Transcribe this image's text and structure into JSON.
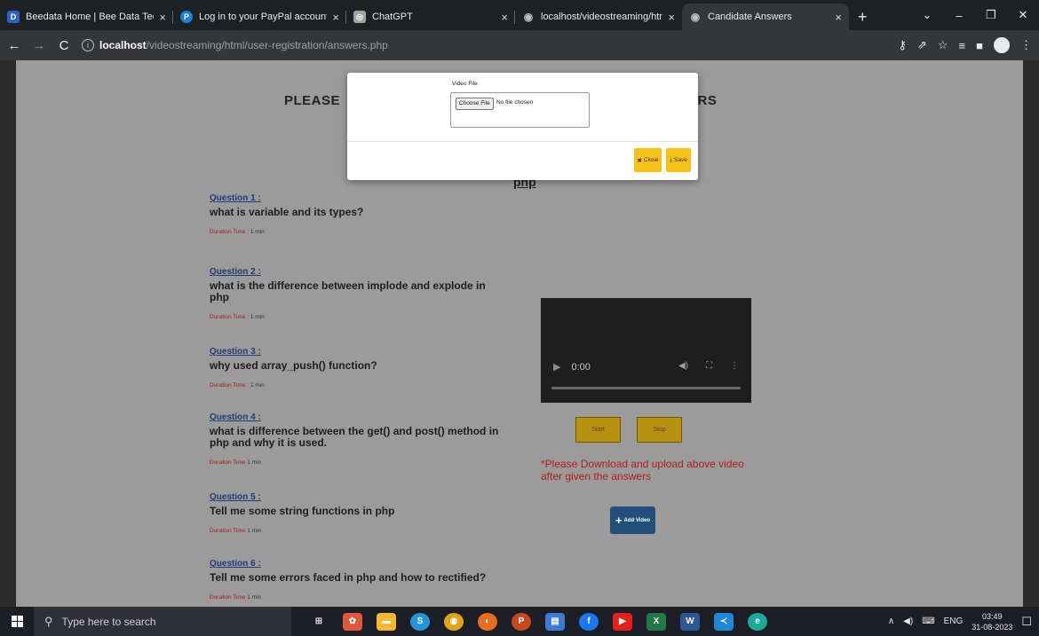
{
  "browser": {
    "tabs": [
      {
        "label": "Beedata Home | Bee Data Techn",
        "icon": "beedata-icon",
        "color": "#2a63c4",
        "glyph": "D"
      },
      {
        "label": "Log in to your PayPal account",
        "icon": "paypal-icon",
        "color": "#1a7fd1",
        "glyph": "P"
      },
      {
        "label": "ChatGPT",
        "icon": "chatgpt-icon",
        "color": "#9aa6a0",
        "glyph": "◎"
      },
      {
        "label": "localhost/videostreaming/html/",
        "icon": "globe-icon",
        "color": "#5f6368",
        "glyph": "◉"
      },
      {
        "label": "Candidate Answers",
        "icon": "globe-icon",
        "color": "#5f6368",
        "glyph": "◉"
      }
    ],
    "url_host": "localhost",
    "url_path": "/videostreaming/html/user-registration/answers.php"
  },
  "page": {
    "heading_left": "PLEASE",
    "heading_right": "ERS",
    "subject": "php",
    "questions": [
      {
        "label": "Question 1 :",
        "text": "what is variable and its types?",
        "dur_label": "Duration Time",
        "dur_value": " : 1 min"
      },
      {
        "label": "Question 2 :",
        "text": "what is the difference between implode and explode in php",
        "dur_label": "Duration Time",
        "dur_value": " : 1 min"
      },
      {
        "label": "Question 3 :",
        "text": "why used array_push() function?",
        "dur_label": "Duration Time",
        "dur_value": " : 1 min"
      },
      {
        "label": "Question 4 :",
        "text": "what is difference between the get() and post() method in php and why it is used.",
        "dur_label": "Duration Time",
        "dur_value": " 1 min"
      },
      {
        "label": "Question 5 :",
        "text": "Tell me some string functions in php",
        "dur_label": "Duration Time",
        "dur_value": " 1 min"
      },
      {
        "label": "Question 6 :",
        "text": "Tell me some errors faced in php and how to rectified?",
        "dur_label": "Duration Time",
        "dur_value": " 1 min"
      }
    ],
    "video_time": "0:00",
    "start_label": "Start",
    "stop_label": "Stop",
    "note": "*Please Download and upload above video after given the answers",
    "add_video_label": "Add Video"
  },
  "modal": {
    "field_label": "Video File",
    "choose_label": "Choose File",
    "no_file_text": "No file chosen",
    "close_label": "Close",
    "save_label": "Save"
  },
  "taskbar": {
    "search_placeholder": "Type here to search",
    "lang": "ENG",
    "time": "03:49",
    "date": "31-08-2023"
  }
}
